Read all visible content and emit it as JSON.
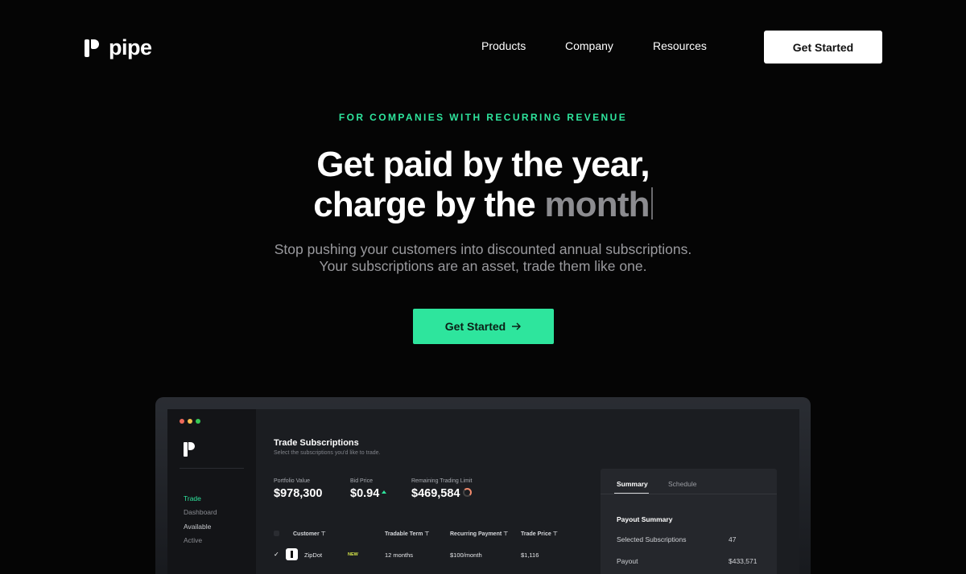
{
  "brand": {
    "name": "pipe"
  },
  "nav": {
    "links": [
      "Products",
      "Company",
      "Resources"
    ],
    "cta": "Get Started"
  },
  "hero": {
    "eyebrow": "FOR COMPANIES WITH RECURRING REVENUE",
    "headline_line1": "Get paid by the year,",
    "headline_line2_prefix": "charge by the ",
    "headline_line2_typed": "month",
    "subhead_line1": "Stop pushing your customers into discounted annual subscriptions.",
    "subhead_line2": "Your subscriptions are an asset, trade them like one.",
    "cta": "Get Started",
    "cta_icon": "arrow-right-icon"
  },
  "app": {
    "window_dots": [
      "#ef6a5b",
      "#f4bf4f",
      "#37c956"
    ],
    "sidebar": [
      "Trade",
      "Dashboard",
      "Available",
      "Active"
    ],
    "active_sidebar": "Trade",
    "title": "Trade Subscriptions",
    "subtitle": "Select the subscriptions you'd like to trade.",
    "stats": [
      {
        "label": "Portfolio Value",
        "value": "$978,300"
      },
      {
        "label": "Bid Price",
        "value": "$0.94"
      },
      {
        "label": "Remaining Trading Limit",
        "value": "$469,584"
      }
    ],
    "table": {
      "headers": [
        "Customer",
        "Tradable Term",
        "Recurring Payment",
        "Trade Price"
      ],
      "row": {
        "customer": "ZipDot",
        "badge": "NEW",
        "term": "12 months",
        "payment": "$100/month",
        "price": "$1,116"
      }
    },
    "panel": {
      "tabs": [
        "Summary",
        "Schedule"
      ],
      "heading": "Payout Summary",
      "rows": [
        {
          "label": "Selected Subscriptions",
          "value": "47"
        },
        {
          "label": "Payout",
          "value": "$433,571"
        }
      ]
    }
  },
  "colors": {
    "accent": "#2ee59d",
    "background": "#050505"
  }
}
